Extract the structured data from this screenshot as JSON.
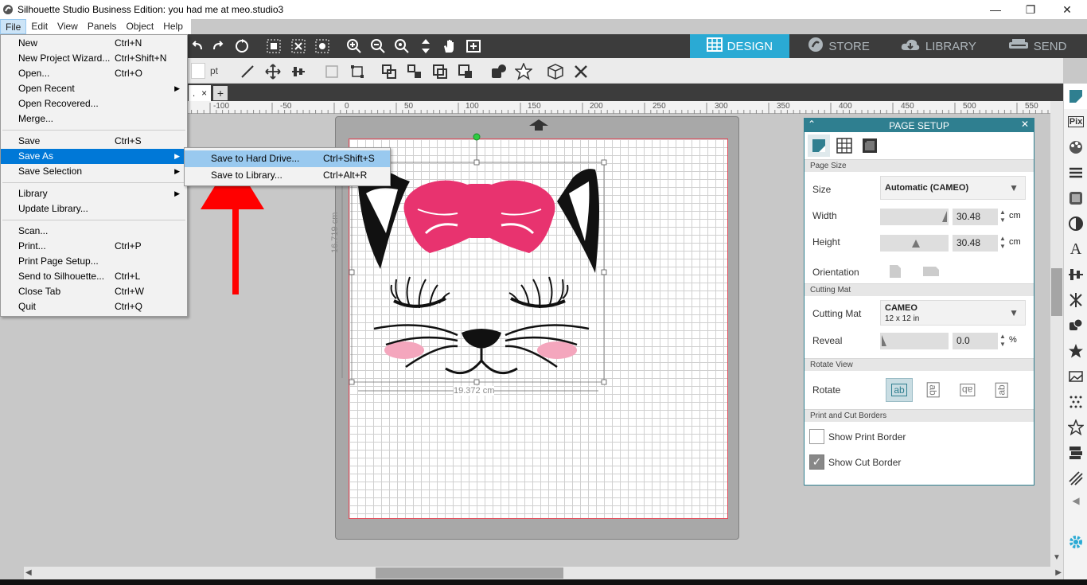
{
  "window": {
    "title": "Silhouette Studio Business Edition: you had me at meo.studio3",
    "minimize": "—",
    "maximize": "❐",
    "close": "✕"
  },
  "menubar": [
    "File",
    "Edit",
    "View",
    "Panels",
    "Object",
    "Help"
  ],
  "toolbar": {
    "unit": "pt"
  },
  "navtabs": [
    {
      "label": "DESIGN",
      "icon": "design-grid-icon"
    },
    {
      "label": "STORE",
      "icon": "store-icon"
    },
    {
      "label": "LIBRARY",
      "icon": "cloud-library-icon"
    },
    {
      "label": "SEND",
      "icon": "send-icon"
    }
  ],
  "doctab": {
    "label": ".",
    "close": "×",
    "add": "+"
  },
  "ruler": {
    "ticks": [
      "-100",
      "-50",
      "0",
      "50",
      "100",
      "150",
      "200",
      "250",
      "300",
      "350",
      "400",
      "450",
      "500",
      "550"
    ]
  },
  "dimensions": {
    "height": "16.719 cm",
    "width": "19.372 cm"
  },
  "file_menu": {
    "items": [
      {
        "label": "New",
        "shortcut": "Ctrl+N"
      },
      {
        "label": "New Project Wizard...",
        "shortcut": "Ctrl+Shift+N"
      },
      {
        "label": "Open...",
        "shortcut": "Ctrl+O"
      },
      {
        "label": "Open Recent",
        "shortcut": "",
        "submenu": true
      },
      {
        "label": "Open Recovered...",
        "shortcut": ""
      },
      {
        "label": "Merge...",
        "shortcut": ""
      },
      {
        "sep": true
      },
      {
        "label": "Save",
        "shortcut": "Ctrl+S"
      },
      {
        "label": "Save As",
        "shortcut": "",
        "submenu": true,
        "highlight": true
      },
      {
        "label": "Save Selection",
        "shortcut": "",
        "submenu": true
      },
      {
        "sep": true
      },
      {
        "label": "Library",
        "shortcut": "",
        "submenu": true
      },
      {
        "label": "Update Library...",
        "shortcut": ""
      },
      {
        "sep": true
      },
      {
        "label": "Scan...",
        "shortcut": ""
      },
      {
        "label": "Print...",
        "shortcut": "Ctrl+P"
      },
      {
        "label": "Print Page Setup...",
        "shortcut": ""
      },
      {
        "label": "Send to Silhouette...",
        "shortcut": "Ctrl+L"
      },
      {
        "label": "Close Tab",
        "shortcut": "Ctrl+W"
      },
      {
        "label": "Quit",
        "shortcut": "Ctrl+Q"
      }
    ]
  },
  "save_as_submenu": [
    {
      "label": "Save to Hard Drive...",
      "shortcut": "Ctrl+Shift+S"
    },
    {
      "label": "Save to Library...",
      "shortcut": "Ctrl+Alt+R"
    }
  ],
  "page_setup": {
    "title": "PAGE SETUP",
    "sections": {
      "page_size": "Page Size",
      "cutting_mat": "Cutting Mat",
      "rotate_view": "Rotate View",
      "borders": "Print and Cut Borders"
    },
    "size_label": "Size",
    "size_value": "Automatic (CAMEO)",
    "width_label": "Width",
    "width_value": "30.48",
    "width_unit": "cm",
    "height_label": "Height",
    "height_value": "30.48",
    "height_unit": "cm",
    "orientation_label": "Orientation",
    "mat_label": "Cutting Mat",
    "mat_value": "CAMEO",
    "mat_sub": "12 x 12 in",
    "reveal_label": "Reveal",
    "reveal_value": "0.0",
    "reveal_unit": "%",
    "rotate_label": "Rotate",
    "rotate_options": [
      "ab",
      "ab",
      "ab",
      "ab"
    ],
    "show_print_border": "Show Print Border",
    "print_border_checked": false,
    "show_cut_border": "Show Cut Border",
    "cut_border_checked": true
  },
  "colors": {
    "accent": "#2aaad4",
    "panel_header": "#2f7f90",
    "menu_highlight": "#0078d7",
    "bow": "#e8336f",
    "cheek": "#f4a6bd",
    "arrow": "#ff0000"
  }
}
